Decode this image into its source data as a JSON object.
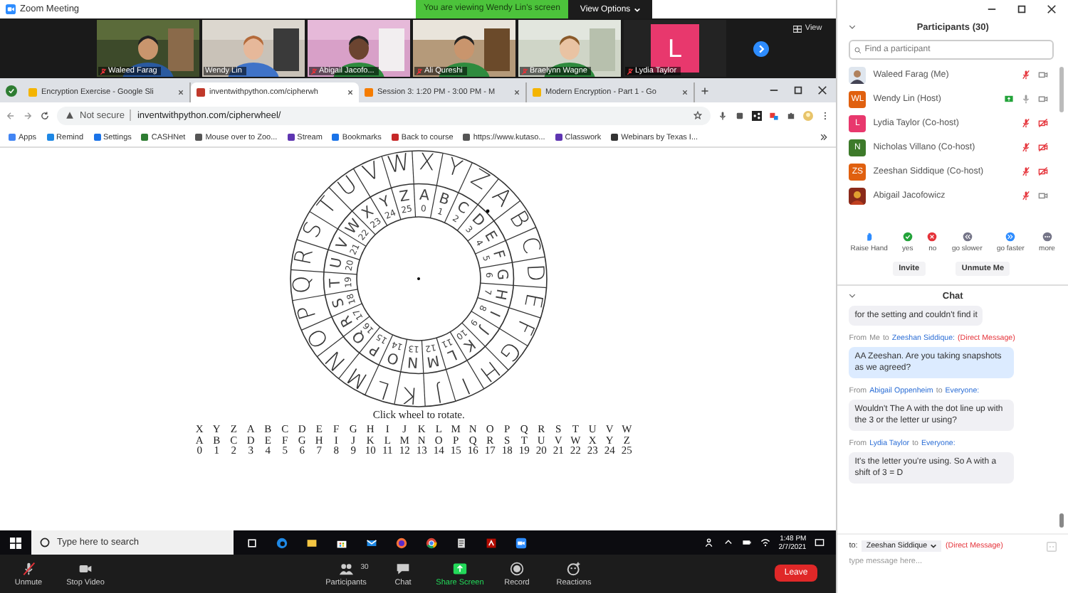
{
  "window": {
    "title": "Zoom Meeting",
    "banner": "You are viewing Wendy Lin's screen",
    "view_options": "View Options"
  },
  "video_strip": {
    "tiles": [
      {
        "name": "Waleed Farag",
        "kind": "video",
        "muted": true
      },
      {
        "name": "Wendy Lin",
        "kind": "video",
        "muted": false
      },
      {
        "name": "Abigail Jacofo...",
        "kind": "video",
        "muted": true
      },
      {
        "name": "Ali Qureshi",
        "kind": "video",
        "muted": true
      },
      {
        "name": "Braelynn Wagne",
        "kind": "video",
        "muted": true
      },
      {
        "name": "Lydia Taylor",
        "kind": "avatar",
        "initial": "L",
        "color": "#e8386d",
        "muted": true
      }
    ],
    "view_label": "View"
  },
  "browser": {
    "tabs": [
      {
        "title": "Encryption Exercise - Google Sli",
        "kind": "slides",
        "selected": false
      },
      {
        "title": "inventwithpython.com/cipherwh",
        "kind": "site",
        "selected": true
      },
      {
        "title": "Session 3: 1:20 PM - 3:00 PM - M",
        "kind": "session",
        "selected": false
      },
      {
        "title": "Modern Encryption - Part 1 - Go",
        "kind": "slides",
        "selected": false
      }
    ],
    "address": {
      "security": "Not secure",
      "url": "inventwithpython.com/cipherwheel/"
    },
    "bookmarks": [
      "Apps",
      "Remind",
      "Settings",
      "CASHNet",
      "Mouse over to Zoo...",
      "Stream",
      "Bookmarks",
      "Back to course",
      "https://www.kutaso...",
      "Classwork",
      "Webinars by Texas I..."
    ]
  },
  "cipher_wheel": {
    "outer_ring": [
      "X",
      "Y",
      "Z",
      "A",
      "B",
      "C",
      "D",
      "E",
      "F",
      "G",
      "H",
      "I",
      "J",
      "K",
      "L",
      "M",
      "N",
      "O",
      "P",
      "Q",
      "R",
      "S",
      "T",
      "U",
      "V",
      "W"
    ],
    "inner_ring": [
      {
        "letter": "A",
        "number": "0"
      },
      {
        "letter": "B",
        "number": "1"
      },
      {
        "letter": "C",
        "number": "2"
      },
      {
        "letter": "D",
        "number": "3"
      },
      {
        "letter": "E",
        "number": "4"
      },
      {
        "letter": "F",
        "number": "5"
      },
      {
        "letter": "G",
        "number": "6"
      },
      {
        "letter": "H",
        "number": "7"
      },
      {
        "letter": "I",
        "number": "8"
      },
      {
        "letter": "J",
        "number": "9"
      },
      {
        "letter": "K",
        "number": "10"
      },
      {
        "letter": "L",
        "number": "11"
      },
      {
        "letter": "M",
        "number": "12"
      },
      {
        "letter": "N",
        "number": "13"
      },
      {
        "letter": "O",
        "number": "14"
      },
      {
        "letter": "P",
        "number": "15"
      },
      {
        "letter": "Q",
        "number": "16"
      },
      {
        "letter": "R",
        "number": "17"
      },
      {
        "letter": "S",
        "number": "18"
      },
      {
        "letter": "T",
        "number": "19"
      },
      {
        "letter": "U",
        "number": "20"
      },
      {
        "letter": "V",
        "number": "21"
      },
      {
        "letter": "W",
        "number": "22"
      },
      {
        "letter": "X",
        "number": "23"
      },
      {
        "letter": "Y",
        "number": "24"
      },
      {
        "letter": "Z",
        "number": "25"
      }
    ],
    "caption": "Click wheel to rotate.",
    "table": {
      "rows": [
        [
          "X",
          "Y",
          "Z",
          "A",
          "B",
          "C",
          "D",
          "E",
          "F",
          "G",
          "H",
          "I",
          "J",
          "K",
          "L",
          "M",
          "N",
          "O",
          "P",
          "Q",
          "R",
          "S",
          "T",
          "U",
          "V",
          "W"
        ],
        [
          "A",
          "B",
          "C",
          "D",
          "E",
          "F",
          "G",
          "H",
          "I",
          "J",
          "K",
          "L",
          "M",
          "N",
          "O",
          "P",
          "Q",
          "R",
          "S",
          "T",
          "U",
          "V",
          "W",
          "X",
          "Y",
          "Z"
        ],
        [
          "0",
          "1",
          "2",
          "3",
          "4",
          "5",
          "6",
          "7",
          "8",
          "9",
          "10",
          "11",
          "12",
          "13",
          "14",
          "15",
          "16",
          "17",
          "18",
          "19",
          "20",
          "21",
          "22",
          "23",
          "24",
          "25"
        ]
      ]
    }
  },
  "taskbar": {
    "search_placeholder": "Type here to search",
    "time": "1:48 PM",
    "date": "2/7/2021"
  },
  "meeting_controls": [
    {
      "label": "Unmute",
      "kind": "mic"
    },
    {
      "label": "Stop Video",
      "kind": "video"
    },
    {
      "label": "Participants",
      "kind": "participants",
      "count": "30"
    },
    {
      "label": "Chat",
      "kind": "chat"
    },
    {
      "label": "Share Screen",
      "kind": "share"
    },
    {
      "label": "Record",
      "kind": "record"
    },
    {
      "label": "Reactions",
      "kind": "reactions"
    }
  ],
  "leave": "Leave",
  "participants_panel": {
    "title": "Participants (30)",
    "search_placeholder": "Find a participant",
    "participants": [
      {
        "name": "Waleed Farag (Me)",
        "muted": true,
        "video_off": false,
        "sharing": false
      },
      {
        "name": "Wendy Lin (Host)",
        "kind": "initials",
        "initials": "WL",
        "color": "#e0600f",
        "muted": false,
        "video_off": false,
        "sharing": true
      },
      {
        "name": "Lydia Taylor (Co-host)",
        "kind": "initials",
        "initials": "L",
        "color": "#e8386d",
        "muted": true,
        "video_off": true,
        "sharing": false
      },
      {
        "name": "Nicholas Villano (Co-host)",
        "kind": "initials",
        "initials": "N",
        "color": "#3d7a2a",
        "muted": true,
        "video_off": true,
        "sharing": false
      },
      {
        "name": "Zeeshan Siddique (Co-host)",
        "kind": "initials",
        "initials": "ZS",
        "color": "#e0600f",
        "muted": true,
        "video_off": true,
        "sharing": false
      },
      {
        "name": "Abigail Jacofowicz",
        "muted": true,
        "video_off": false,
        "sharing": false
      }
    ],
    "reactions": [
      {
        "label": "Raise Hand",
        "kind": "hand"
      },
      {
        "label": "yes",
        "kind": "yes"
      },
      {
        "label": "no",
        "kind": "no"
      },
      {
        "label": "go slower",
        "kind": "slower"
      },
      {
        "label": "go faster",
        "kind": "faster"
      },
      {
        "label": "more",
        "kind": "more"
      }
    ],
    "buttons": [
      "Invite",
      "Unmute Me"
    ]
  },
  "chat": {
    "title": "Chat",
    "messages": [
      {
        "text": "for the setting and couldn't find it",
        "mine": false
      },
      {
        "header": {
          "from": "From",
          "sender": "Me",
          "to": "to",
          "recipient": "Zeeshan Siddique:",
          "note": "(Direct Message)"
        },
        "text": "AA Zeeshan. Are you taking snapshots as we agreed?",
        "mine": true
      },
      {
        "header": {
          "from": "From",
          "sender": "Abigail Oppenheim",
          "to": "to",
          "recipient": "Everyone:"
        },
        "text": "Wouldn't The A with the dot line up with the 3 or the letter ur using?",
        "mine": false
      },
      {
        "header": {
          "from": "From",
          "sender": "Lydia Taylor",
          "to": "to",
          "recipient": "Everyone:"
        },
        "text": "It's the letter you're using.  So A with a shift of 3 = D",
        "mine": false
      }
    ],
    "compose": {
      "to_label": "to:",
      "recipient": "Zeeshan Siddique",
      "note": "(Direct Message)",
      "placeholder": "type message here..."
    }
  }
}
